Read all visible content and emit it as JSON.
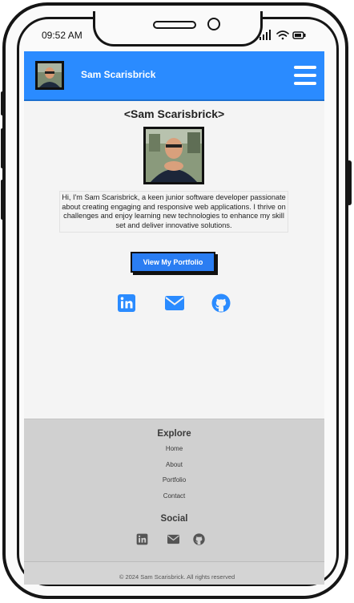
{
  "status_bar": {
    "time": "09:52 AM"
  },
  "navbar": {
    "name": "Sam Scarisbrick"
  },
  "main": {
    "title": "<Sam Scarisbrick>",
    "bio": "Hi, I'm Sam Scarisbrick, a keen junior software developer passionate about creating engaging and responsive web applications. I thrive on challenges and enjoy learning new technologies to enhance my skill set and deliver innovative solutions.",
    "cta_label": "View My Portfolio",
    "social_icons": [
      "linkedin-icon",
      "email-icon",
      "github-icon"
    ]
  },
  "footer": {
    "explore_heading": "Explore",
    "links": [
      "Home",
      "About",
      "Portfolio",
      "Contact"
    ],
    "social_heading": "Social",
    "copyright": "© 2024 Sam Scarisbrick. All rights reserved"
  },
  "colors": {
    "accent": "#2a8bff",
    "button": "#2a7df2",
    "footer": "#d0d0d0"
  }
}
